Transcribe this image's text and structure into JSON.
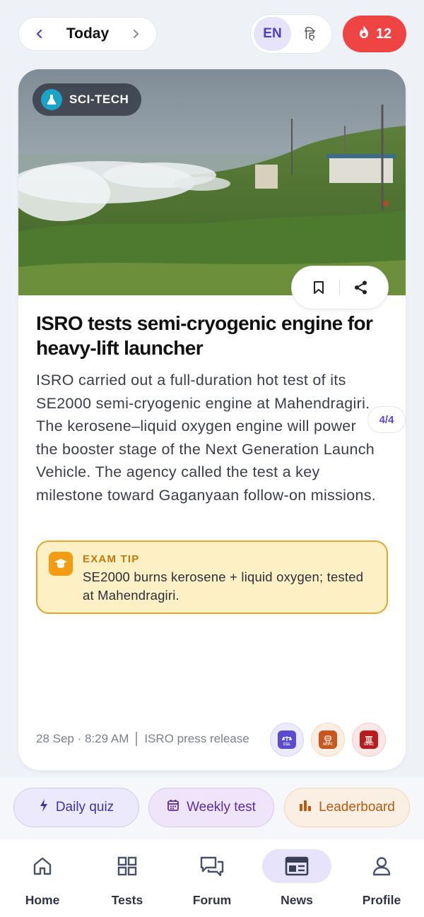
{
  "header": {
    "date_label": "Today",
    "lang_en": "EN",
    "lang_hi": "हि",
    "streak_count": "12"
  },
  "article": {
    "category": "SCI-TECH",
    "title": "ISRO tests semi-cryogenic engine for heavy-lift launcher",
    "body": "ISRO carried out a full-duration hot test of its SE2000 semi-cryogenic engine at Mahendragiri. The kerosene–liquid oxygen engine will power the booster stage of the Next Generation Launch Vehicle. The agency called the test a key milestone toward Gaganyaan follow-on missions.",
    "page_indicator": "4/4",
    "tip_label": "EXAM TIP",
    "tip_text": "SE2000 burns kerosene + liquid oxygen; tested at Mahendragiri.",
    "date": "28 Sep · 8:29 AM",
    "source": "ISRO press release",
    "exams": [
      {
        "label": "CGL",
        "color": "#5b4bd1"
      },
      {
        "label": "NTPC",
        "color": "#c9561c"
      },
      {
        "label": "UPSC",
        "color": "#b91c1c"
      }
    ]
  },
  "quick_actions": {
    "daily_quiz": "Daily quiz",
    "weekly_test": "Weekly test",
    "leaderboard": "Leaderboard"
  },
  "nav": {
    "items": [
      {
        "label": "Home",
        "icon": "home-icon"
      },
      {
        "label": "Tests",
        "icon": "grid-icon"
      },
      {
        "label": "Forum",
        "icon": "chat-icon"
      },
      {
        "label": "News",
        "icon": "newspaper-icon",
        "active": true
      },
      {
        "label": "Profile",
        "icon": "user-icon"
      }
    ]
  },
  "colors": {
    "accent": "#5b4bd1",
    "streak": "#ef4444",
    "tip_border": "#e9a52a"
  }
}
